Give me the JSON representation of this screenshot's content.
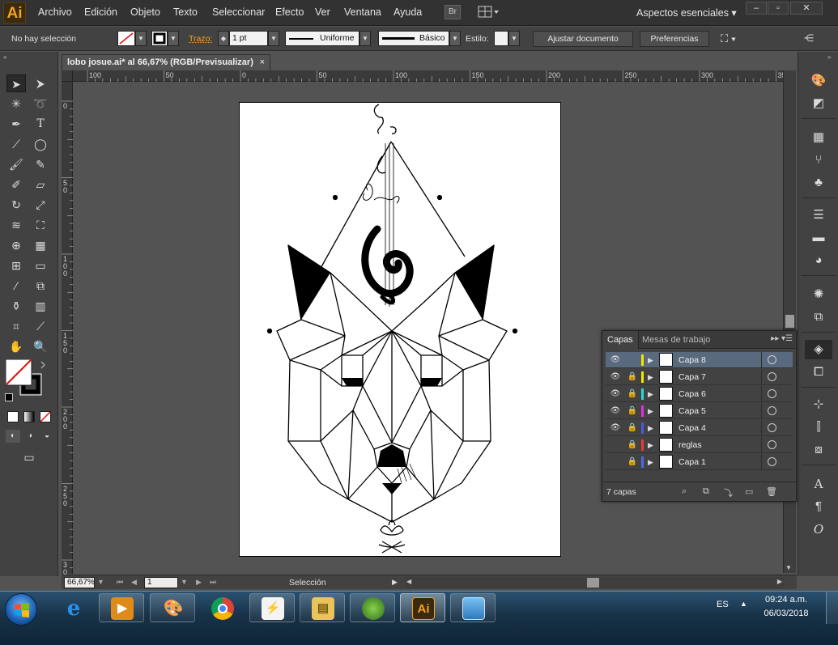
{
  "app": {
    "logo": "Ai",
    "menu": [
      "Archivo",
      "Edición",
      "Objeto",
      "Texto",
      "Seleccionar",
      "Efecto",
      "Ver",
      "Ventana",
      "Ayuda"
    ],
    "bridge_label": "Br",
    "workspace": "Aspectos esenciales",
    "window_controls": {
      "minimize": "–",
      "maximize": "▫",
      "close": "✕"
    }
  },
  "control_bar": {
    "selection_status": "No hay selección",
    "stroke_label": "Trazo:",
    "stroke_weight": "1 pt",
    "profile": "Uniforme",
    "brush": "Básico",
    "style_label": "Estilo:",
    "fit_button": "Ajustar documento",
    "prefs_button": "Preferencias"
  },
  "document": {
    "tab_title": "lobo josue.ai* al 66,67% (RGB/Previsualizar)",
    "close_glyph": "×",
    "ruler_top": [
      {
        "label": "100",
        "v": 100
      },
      {
        "label": "50",
        "v": 150
      },
      {
        "label": "0",
        "v": 200
      },
      {
        "label": "50",
        "v": 250
      },
      {
        "label": "100",
        "v": 300
      },
      {
        "label": "150",
        "v": 350
      },
      {
        "label": "200",
        "v": 400
      },
      {
        "label": "250",
        "v": 450
      },
      {
        "label": "300",
        "v": 500
      },
      {
        "label": "35",
        "v": 550
      }
    ],
    "ruler_left": [
      "0",
      "50",
      "100",
      "150",
      "200",
      "250",
      "300"
    ]
  },
  "status_bar": {
    "zoom": "66,67%",
    "artboard_number": "1",
    "status_text": "Selección"
  },
  "layers_panel": {
    "tabs": [
      "Capas",
      "Mesas de trabajo"
    ],
    "layers": [
      {
        "name": "Capa 8",
        "color": "#f5e600",
        "visible": true,
        "locked": false,
        "selected": true
      },
      {
        "name": "Capa 7",
        "color": "#f5e600",
        "visible": true,
        "locked": true,
        "selected": false
      },
      {
        "name": "Capa 6",
        "color": "#28d8d8",
        "visible": true,
        "locked": true,
        "selected": false
      },
      {
        "name": "Capa 5",
        "color": "#e030e0",
        "visible": true,
        "locked": true,
        "selected": false
      },
      {
        "name": "Capa 4",
        "color": "#4a5adc",
        "visible": true,
        "locked": true,
        "selected": false
      },
      {
        "name": "reglas",
        "color": "#e83a3a",
        "visible": false,
        "locked": true,
        "selected": false
      },
      {
        "name": "Capa 1",
        "color": "#4a6ae8",
        "visible": false,
        "locked": true,
        "selected": false
      }
    ],
    "count_label": "7 capas"
  },
  "taskbar": {
    "language": "ES",
    "time": "09:24 a.m.",
    "date": "06/03/2018",
    "apps": [
      "internet-explorer",
      "media-player",
      "paint",
      "chrome",
      "acrobat",
      "file-explorer",
      "games",
      "illustrator",
      "photo-viewer"
    ],
    "illustrator_glyph": "Ai"
  },
  "colors": {
    "accent_orange": "#f7a21b",
    "panel_bg": "#424242",
    "canvas_bg": "#535353",
    "selected_layer": "#5a6a7e"
  }
}
